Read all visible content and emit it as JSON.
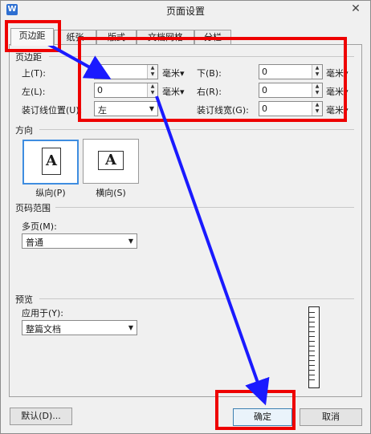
{
  "window": {
    "title": "页面设置",
    "app_icon": "W",
    "close_glyph": "✕"
  },
  "tabs": [
    "页边距",
    "纸张",
    "版式",
    "文档网格",
    "分栏"
  ],
  "margins": {
    "group_title": "页边距",
    "top_label": "上(T):",
    "top_value": "0",
    "top_unit": "毫米▾",
    "bottom_label": "下(B):",
    "bottom_value": "0",
    "bottom_unit": "毫米▾",
    "left_label": "左(L):",
    "left_value": "0",
    "left_unit": "毫米▾",
    "right_label": "右(R):",
    "right_value": "0",
    "right_unit": "毫米▾",
    "gutter_pos_label": "装订线位置(U):",
    "gutter_pos_value": "左",
    "gutter_width_label": "装订线宽(G):",
    "gutter_width_value": "0",
    "gutter_width_unit": "毫米▾"
  },
  "orientation": {
    "group_title": "方向",
    "portrait_label": "纵向(P)",
    "landscape_label": "横向(S)",
    "page_glyph": "A"
  },
  "page_range": {
    "group_title": "页码范围",
    "multi_label": "多页(M):",
    "multi_value": "普通"
  },
  "preview": {
    "group_title": "预览",
    "apply_label": "应用于(Y):",
    "apply_value": "整篇文档"
  },
  "buttons": {
    "default_label": "默认(D)...",
    "ok_label": "确定",
    "cancel_label": "取消"
  },
  "annotation_color": "#ee0000",
  "arrow_color": "#1a1aff"
}
